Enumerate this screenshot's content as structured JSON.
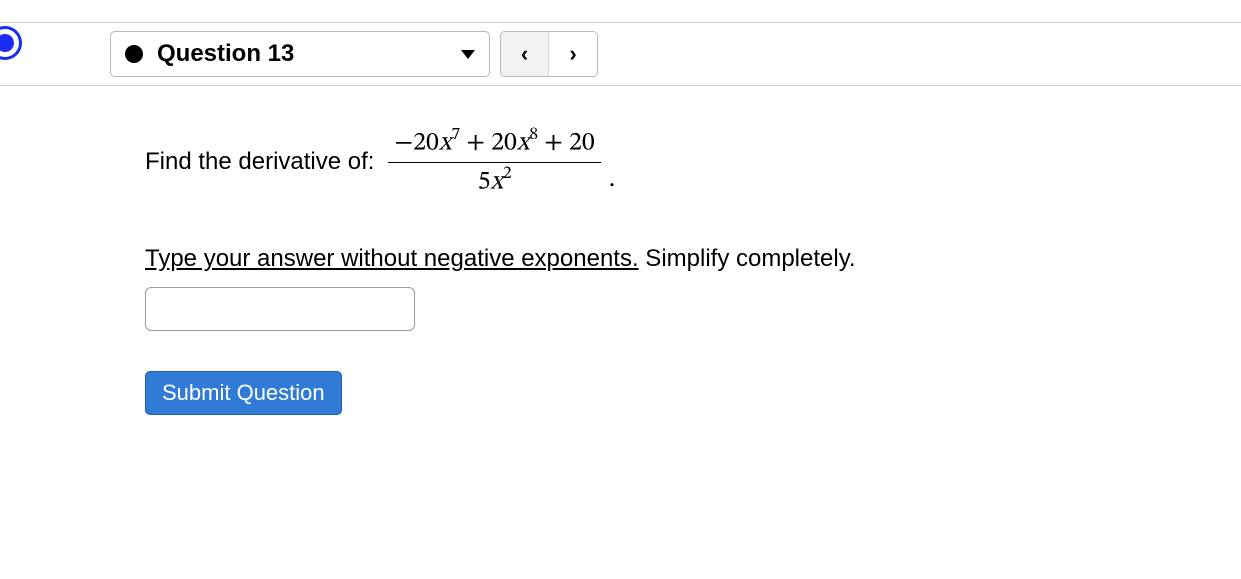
{
  "nav": {
    "question_label": "Question 13",
    "prev": "‹",
    "next": "›"
  },
  "prompt": {
    "lead": "Find the derivative of:",
    "numerator_a_coef": "−20",
    "numerator_a_var": "x",
    "numerator_a_exp": "7",
    "plus1": " + ",
    "numerator_b_coef": "20",
    "numerator_b_var": "x",
    "numerator_b_exp": "8",
    "plus2": " + ",
    "numerator_c": "20",
    "denom_coef": "5",
    "denom_var": "x",
    "denom_exp": "2",
    "period": "."
  },
  "instruction": {
    "underlined": "Type your answer without negative exponents.",
    "rest": " Simplify completely."
  },
  "answer_value": "",
  "submit_label": "Submit Question"
}
